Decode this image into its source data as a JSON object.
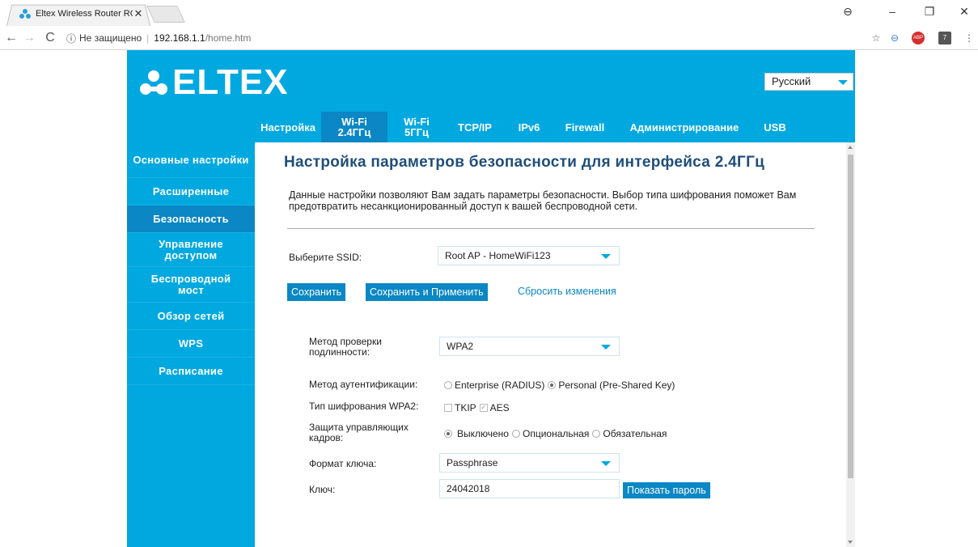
{
  "browser": {
    "tab_title": "Eltex Wireless Router RG-",
    "url_security": "Не защищено",
    "url_host": "192.168.1.1",
    "url_path": "/home.htm"
  },
  "header": {
    "logo_text": "ELTEX",
    "language": "Русский"
  },
  "topnav": [
    {
      "label": "Настройка"
    },
    {
      "label": "Wi-Fi\n2.4ГГц"
    },
    {
      "label": "Wi-Fi\n5ГГц"
    },
    {
      "label": "TCP/IP"
    },
    {
      "label": "IPv6"
    },
    {
      "label": "Firewall"
    },
    {
      "label": "Администрирование"
    },
    {
      "label": "USB"
    }
  ],
  "sidebar": [
    {
      "label": "Основные настройки"
    },
    {
      "label": "Расширенные"
    },
    {
      "label": "Безопасность"
    },
    {
      "label": "Управление доступом"
    },
    {
      "label": "Беспроводной мост"
    },
    {
      "label": "Обзор сетей"
    },
    {
      "label": "WPS"
    },
    {
      "label": "Расписание"
    }
  ],
  "main": {
    "title": "Настройка параметров безопасности для интерфейса 2.4ГГц",
    "description": "Данные настройки позволяют Вам задать параметры безопасности. Выбор типа шифрования поможет Вам предотвратить несанкционированный доступ к вашей беспроводной сети.",
    "ssid_label": "Выберите SSID:",
    "ssid_value": "Root AP - HomeWiFi123",
    "save_label": "Сохранить",
    "save_apply_label": "Сохранить и Применить",
    "reset_label": "Сбросить изменения",
    "auth_check_label": "Метод проверки подлинности:",
    "auth_check_value": "WPA2",
    "auth_method_label": "Метод аутентификации:",
    "auth_enterprise": "Enterprise (RADIUS)",
    "auth_personal": "Personal (Pre-Shared Key)",
    "cipher_label": "Тип шифрования WPA2:",
    "cipher_tkip": "TKIP",
    "cipher_aes": "AES",
    "pmf_label": "Защита управляющих кадров:",
    "pmf_off": "Выключено",
    "pmf_optional": "Опциональная",
    "pmf_required": "Обязательная",
    "key_format_label": "Формат ключа:",
    "key_format_value": "Passphrase",
    "key_label": "Ключ:",
    "key_value": "24042018",
    "show_password_label": "Показать пароль"
  }
}
